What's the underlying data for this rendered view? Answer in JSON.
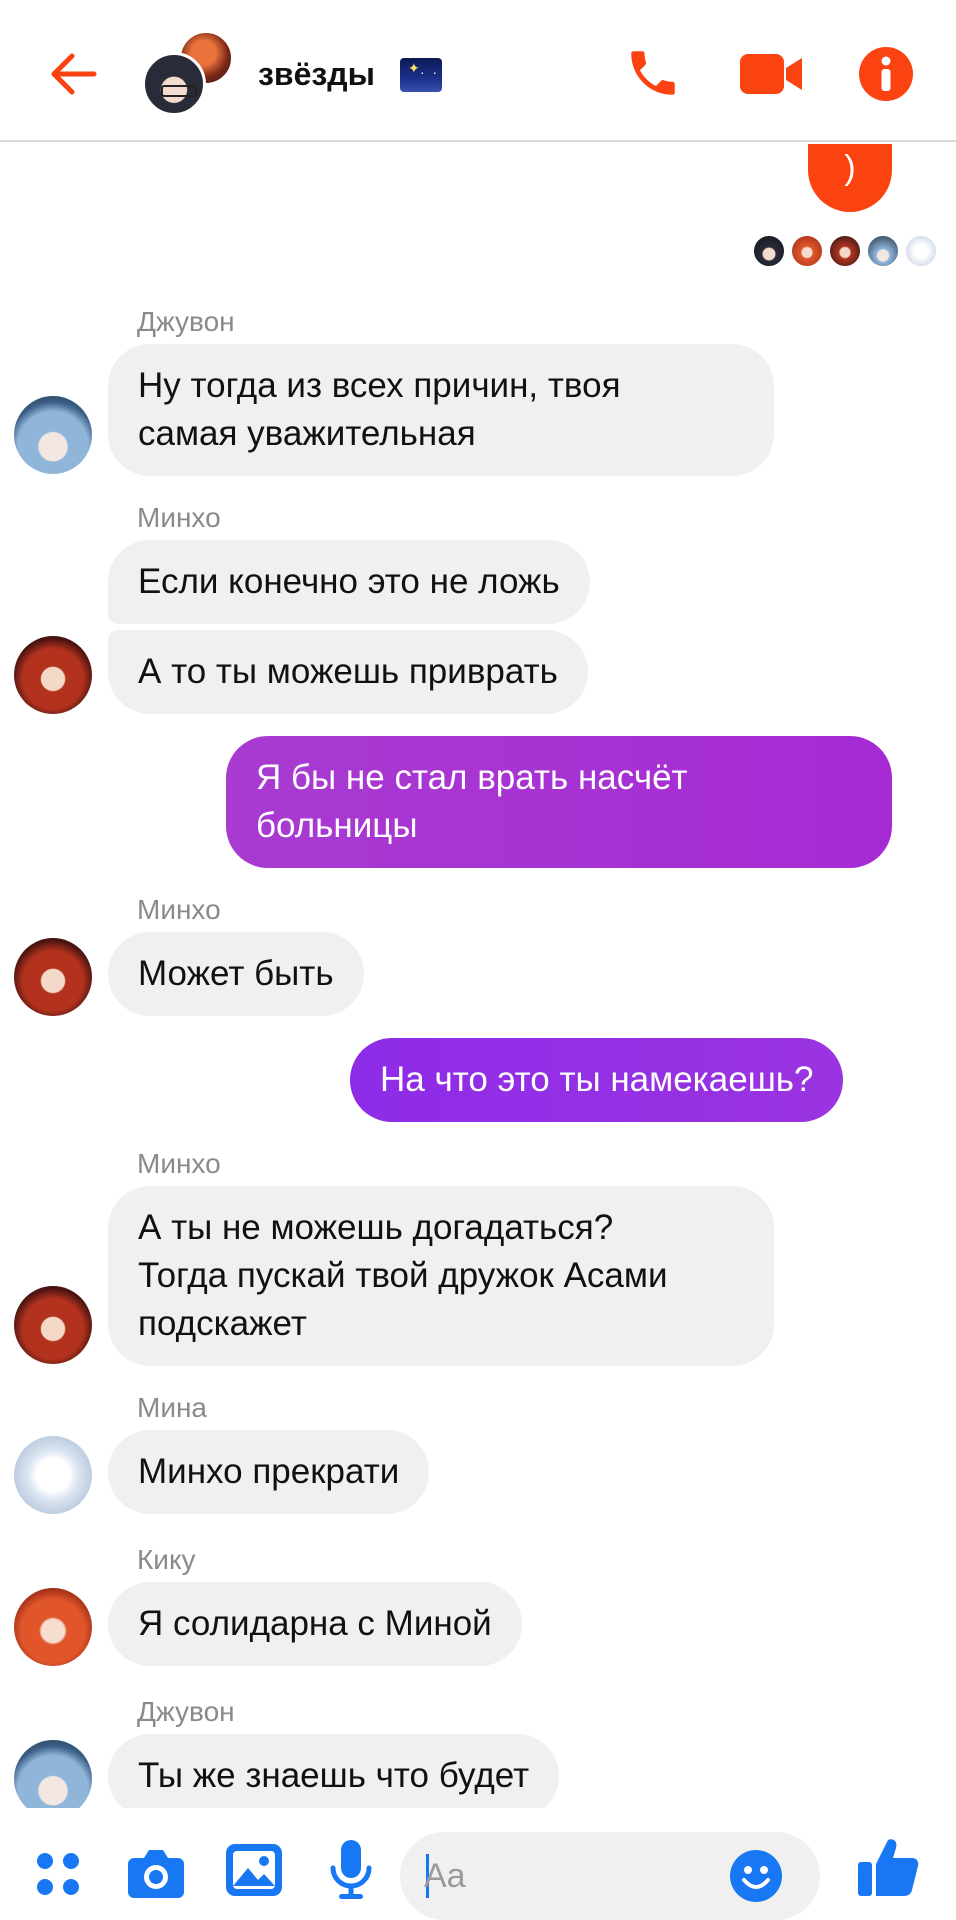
{
  "header": {
    "title": "звёзды",
    "back_icon": "arrow-left-icon",
    "call_icon": "phone-icon",
    "video_icon": "video-camera-icon",
    "info_icon": "info-icon",
    "accent_color": "#fa4311"
  },
  "top_reaction": {
    "text": ")"
  },
  "messages": [
    {
      "sender": "Джувон",
      "text": "Ну тогда из всех причин, твоя\nсамая уважительная"
    },
    {
      "sender": "Минхо",
      "text": "Если конечно это не ложь"
    },
    {
      "text": "А то ты можешь приврать"
    },
    {
      "text": "Я бы не стал врать насчёт\nбольницы"
    },
    {
      "sender": "Минхо",
      "text": "Может быть"
    },
    {
      "text": "На что это ты намекаешь?"
    },
    {
      "sender": "Минхо",
      "text": "А ты не можешь догадаться?\nТогда пускай твой дружок Асами\nподскажет"
    },
    {
      "sender": "Мина",
      "text": "Минхо прекрати"
    },
    {
      "sender": "Кику",
      "text": "Я солидарна с Миной"
    },
    {
      "sender": "Джувон",
      "text": "Ты же знаешь что будет"
    }
  ],
  "composer": {
    "placeholder": "Aa",
    "menu_icon": "grid-dots-icon",
    "camera_icon": "camera-icon",
    "gallery_icon": "image-icon",
    "mic_icon": "microphone-icon",
    "emoji_icon": "smiley-icon",
    "like_icon": "thumbs-up-icon",
    "accent_color": "#1877f2"
  }
}
